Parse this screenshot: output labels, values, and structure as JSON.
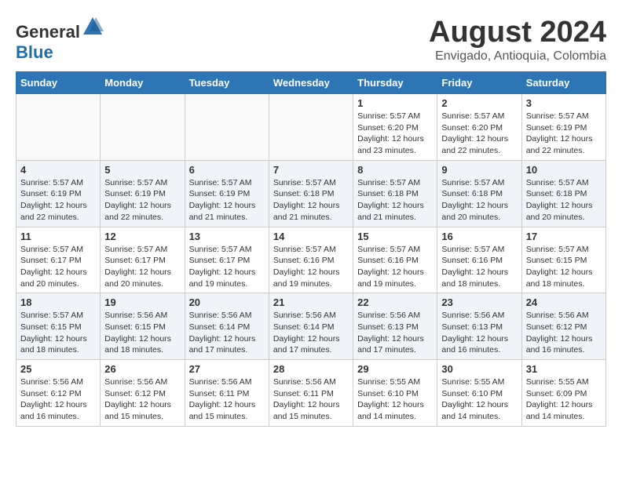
{
  "header": {
    "logo_general": "General",
    "logo_blue": "Blue",
    "month_year": "August 2024",
    "location": "Envigado, Antioquia, Colombia"
  },
  "weekdays": [
    "Sunday",
    "Monday",
    "Tuesday",
    "Wednesday",
    "Thursday",
    "Friday",
    "Saturday"
  ],
  "weeks": [
    {
      "row_class": "row-white",
      "days": [
        {
          "date": "",
          "empty": true
        },
        {
          "date": "",
          "empty": true
        },
        {
          "date": "",
          "empty": true
        },
        {
          "date": "",
          "empty": true
        },
        {
          "date": "1",
          "sunrise": "5:57 AM",
          "sunset": "6:20 PM",
          "daylight": "12 hours and 23 minutes."
        },
        {
          "date": "2",
          "sunrise": "5:57 AM",
          "sunset": "6:20 PM",
          "daylight": "12 hours and 22 minutes."
        },
        {
          "date": "3",
          "sunrise": "5:57 AM",
          "sunset": "6:19 PM",
          "daylight": "12 hours and 22 minutes."
        }
      ]
    },
    {
      "row_class": "row-gray",
      "days": [
        {
          "date": "4",
          "sunrise": "5:57 AM",
          "sunset": "6:19 PM",
          "daylight": "12 hours and 22 minutes."
        },
        {
          "date": "5",
          "sunrise": "5:57 AM",
          "sunset": "6:19 PM",
          "daylight": "12 hours and 22 minutes."
        },
        {
          "date": "6",
          "sunrise": "5:57 AM",
          "sunset": "6:19 PM",
          "daylight": "12 hours and 21 minutes."
        },
        {
          "date": "7",
          "sunrise": "5:57 AM",
          "sunset": "6:18 PM",
          "daylight": "12 hours and 21 minutes."
        },
        {
          "date": "8",
          "sunrise": "5:57 AM",
          "sunset": "6:18 PM",
          "daylight": "12 hours and 21 minutes."
        },
        {
          "date": "9",
          "sunrise": "5:57 AM",
          "sunset": "6:18 PM",
          "daylight": "12 hours and 20 minutes."
        },
        {
          "date": "10",
          "sunrise": "5:57 AM",
          "sunset": "6:18 PM",
          "daylight": "12 hours and 20 minutes."
        }
      ]
    },
    {
      "row_class": "row-white",
      "days": [
        {
          "date": "11",
          "sunrise": "5:57 AM",
          "sunset": "6:17 PM",
          "daylight": "12 hours and 20 minutes."
        },
        {
          "date": "12",
          "sunrise": "5:57 AM",
          "sunset": "6:17 PM",
          "daylight": "12 hours and 20 minutes."
        },
        {
          "date": "13",
          "sunrise": "5:57 AM",
          "sunset": "6:17 PM",
          "daylight": "12 hours and 19 minutes."
        },
        {
          "date": "14",
          "sunrise": "5:57 AM",
          "sunset": "6:16 PM",
          "daylight": "12 hours and 19 minutes."
        },
        {
          "date": "15",
          "sunrise": "5:57 AM",
          "sunset": "6:16 PM",
          "daylight": "12 hours and 19 minutes."
        },
        {
          "date": "16",
          "sunrise": "5:57 AM",
          "sunset": "6:16 PM",
          "daylight": "12 hours and 18 minutes."
        },
        {
          "date": "17",
          "sunrise": "5:57 AM",
          "sunset": "6:15 PM",
          "daylight": "12 hours and 18 minutes."
        }
      ]
    },
    {
      "row_class": "row-gray",
      "days": [
        {
          "date": "18",
          "sunrise": "5:57 AM",
          "sunset": "6:15 PM",
          "daylight": "12 hours and 18 minutes."
        },
        {
          "date": "19",
          "sunrise": "5:56 AM",
          "sunset": "6:15 PM",
          "daylight": "12 hours and 18 minutes."
        },
        {
          "date": "20",
          "sunrise": "5:56 AM",
          "sunset": "6:14 PM",
          "daylight": "12 hours and 17 minutes."
        },
        {
          "date": "21",
          "sunrise": "5:56 AM",
          "sunset": "6:14 PM",
          "daylight": "12 hours and 17 minutes."
        },
        {
          "date": "22",
          "sunrise": "5:56 AM",
          "sunset": "6:13 PM",
          "daylight": "12 hours and 17 minutes."
        },
        {
          "date": "23",
          "sunrise": "5:56 AM",
          "sunset": "6:13 PM",
          "daylight": "12 hours and 16 minutes."
        },
        {
          "date": "24",
          "sunrise": "5:56 AM",
          "sunset": "6:12 PM",
          "daylight": "12 hours and 16 minutes."
        }
      ]
    },
    {
      "row_class": "row-white",
      "days": [
        {
          "date": "25",
          "sunrise": "5:56 AM",
          "sunset": "6:12 PM",
          "daylight": "12 hours and 16 minutes."
        },
        {
          "date": "26",
          "sunrise": "5:56 AM",
          "sunset": "6:12 PM",
          "daylight": "12 hours and 15 minutes."
        },
        {
          "date": "27",
          "sunrise": "5:56 AM",
          "sunset": "6:11 PM",
          "daylight": "12 hours and 15 minutes."
        },
        {
          "date": "28",
          "sunrise": "5:56 AM",
          "sunset": "6:11 PM",
          "daylight": "12 hours and 15 minutes."
        },
        {
          "date": "29",
          "sunrise": "5:55 AM",
          "sunset": "6:10 PM",
          "daylight": "12 hours and 14 minutes."
        },
        {
          "date": "30",
          "sunrise": "5:55 AM",
          "sunset": "6:10 PM",
          "daylight": "12 hours and 14 minutes."
        },
        {
          "date": "31",
          "sunrise": "5:55 AM",
          "sunset": "6:09 PM",
          "daylight": "12 hours and 14 minutes."
        }
      ]
    }
  ]
}
